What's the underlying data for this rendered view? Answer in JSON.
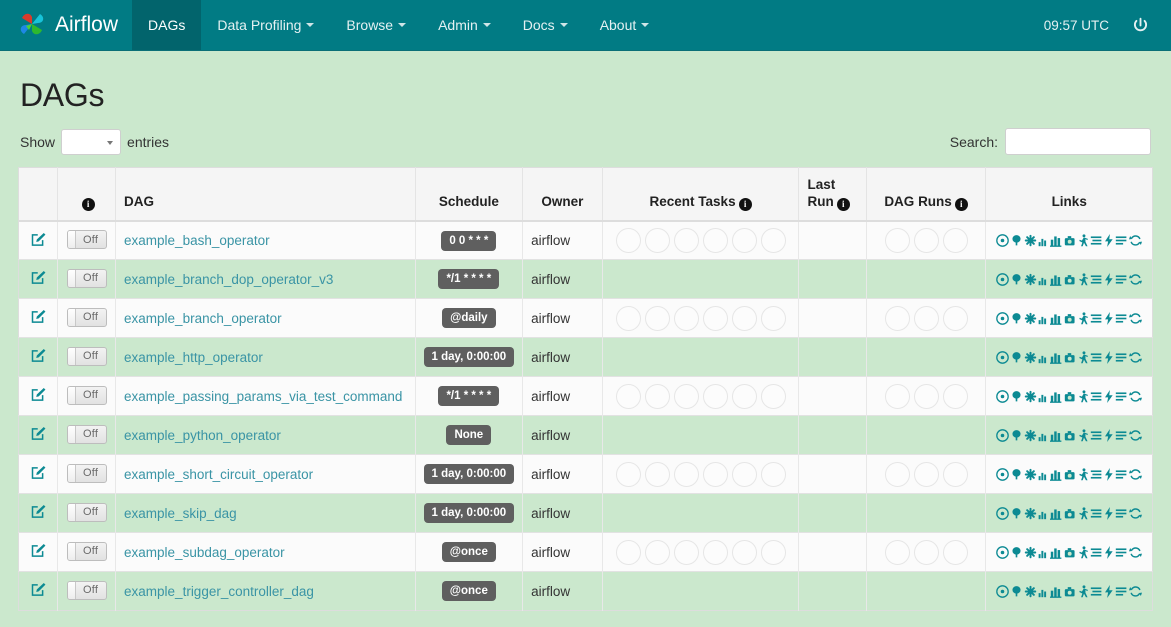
{
  "navbar": {
    "brand": "Airflow",
    "brand_icon": "airflow-pinwheel-logo",
    "items": [
      {
        "label": "DAGs",
        "active": true,
        "caret": false
      },
      {
        "label": "Data Profiling",
        "active": false,
        "caret": true
      },
      {
        "label": "Browse",
        "active": false,
        "caret": true
      },
      {
        "label": "Admin",
        "active": false,
        "caret": true
      },
      {
        "label": "Docs",
        "active": false,
        "caret": true
      },
      {
        "label": "About",
        "active": false,
        "caret": true
      }
    ],
    "clock": "09:57 UTC",
    "power_icon": "power-icon"
  },
  "page": {
    "title": "DAGs"
  },
  "controls": {
    "show_label": "Show",
    "entries_label": "entries",
    "entries_value": "",
    "search_label": "Search:",
    "search_value": "",
    "search_placeholder": ""
  },
  "table": {
    "headers": {
      "edit": "",
      "info": "",
      "dag": "DAG",
      "schedule": "Schedule",
      "owner": "Owner",
      "recent_tasks": "Recent Tasks",
      "last_run_line1": "Last",
      "last_run_line2": "Run",
      "dag_runs": "DAG Runs",
      "links": "Links"
    },
    "toggle_label": "Off",
    "recent_task_slots": 6,
    "dag_run_slots": 3,
    "link_icons": [
      "trigger-dag-icon",
      "tree-view-icon",
      "graph-view-icon",
      "task-duration-icon",
      "task-tries-icon",
      "landing-times-icon",
      "gantt-icon",
      "details-icon",
      "code-icon",
      "logs-icon",
      "refresh-icon"
    ],
    "rows": [
      {
        "name": "example_bash_operator",
        "schedule": "0 0 * * *",
        "owner": "airflow",
        "last_run": "",
        "show_circles": true
      },
      {
        "name": "example_branch_dop_operator_v3",
        "schedule": "*/1 * * * *",
        "owner": "airflow",
        "last_run": "",
        "show_circles": false
      },
      {
        "name": "example_branch_operator",
        "schedule": "@daily",
        "owner": "airflow",
        "last_run": "",
        "show_circles": true
      },
      {
        "name": "example_http_operator",
        "schedule": "1 day, 0:00:00",
        "owner": "airflow",
        "last_run": "",
        "show_circles": false
      },
      {
        "name": "example_passing_params_via_test_command",
        "schedule": "*/1 * * * *",
        "owner": "airflow",
        "last_run": "",
        "show_circles": true
      },
      {
        "name": "example_python_operator",
        "schedule": "None",
        "owner": "airflow",
        "last_run": "",
        "show_circles": false
      },
      {
        "name": "example_short_circuit_operator",
        "schedule": "1 day, 0:00:00",
        "owner": "airflow",
        "last_run": "",
        "show_circles": true
      },
      {
        "name": "example_skip_dag",
        "schedule": "1 day, 0:00:00",
        "owner": "airflow",
        "last_run": "",
        "show_circles": false
      },
      {
        "name": "example_subdag_operator",
        "schedule": "@once",
        "owner": "airflow",
        "last_run": "",
        "show_circles": true
      },
      {
        "name": "example_trigger_controller_dag",
        "schedule": "@once",
        "owner": "airflow",
        "last_run": "",
        "show_circles": false
      }
    ]
  },
  "colors": {
    "navbar": "#017b84",
    "navbar_active": "#02646c",
    "page_background": "#cbe8cd",
    "link": "#3a94a5",
    "icon_teal": "#0c8a93",
    "badge": "#5f5f5f",
    "row_odd": "#fbfbfb",
    "row_even": "#cbe8cd"
  }
}
